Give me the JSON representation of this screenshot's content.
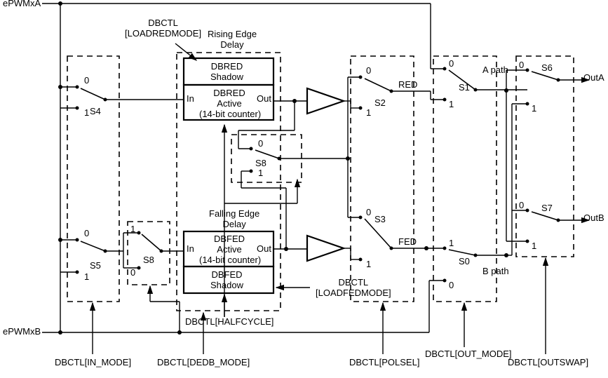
{
  "inputs": {
    "a": "ePWMxA",
    "b": "ePWMxB"
  },
  "outputs": {
    "a": "OutA",
    "b": "OutB"
  },
  "switches": {
    "s0": "S0",
    "s1": "S1",
    "s2": "S2",
    "s3": "S3",
    "s4": "S4",
    "s5": "S5",
    "s6": "S6",
    "s7": "S7",
    "s8_in": "S8",
    "s8_mid": "S8"
  },
  "positions": {
    "zero": "0",
    "one": "1"
  },
  "blocks": {
    "rising_title": "Rising Edge\nDelay",
    "falling_title": "Falling Edge\nDelay",
    "dbred_shadow": "DBRED\nShadow",
    "dbred_active": "DBRED\nActive\n(14-bit counter)",
    "dbfed_active": "DBFED\nActive\n(14-bit counter)",
    "dbfed_shadow": "DBFED\nShadow",
    "port_in": "In",
    "port_out": "Out"
  },
  "paths": {
    "a_path": "A path",
    "b_path": "B path",
    "red": "RED",
    "fed": "FED"
  },
  "controls": {
    "loadred": "DBCTL\n[LOADREDMODE]",
    "loadfed": "DBCTL\n[LOADFEDMODE]",
    "halfcycle": "DBCTL[HALFCYCLE]",
    "in_mode": "DBCTL[IN_MODE]",
    "dedb_mode": "DBCTL[DEDB_MODE]",
    "polsel": "DBCTL[POLSEL]",
    "out_mode": "DBCTL[OUT_MODE]",
    "outswap": "DBCTL[OUTSWAP]"
  }
}
